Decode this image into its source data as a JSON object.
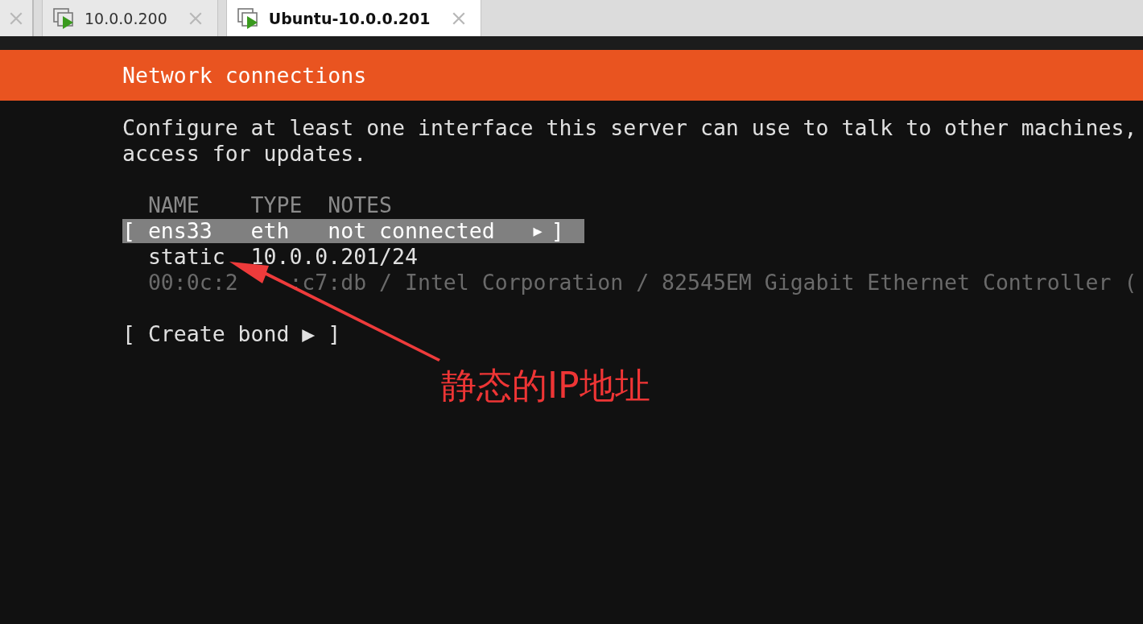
{
  "tabs": [
    {
      "label": "10.0.0.200",
      "selected": false
    },
    {
      "label": "Ubuntu-10.0.0.201",
      "selected": true
    }
  ],
  "header": {
    "title": "Network connections"
  },
  "description": [
    "Configure at least one interface this server can use to talk to other machines,",
    "access for updates."
  ],
  "table": {
    "columns": [
      "NAME",
      "TYPE",
      "NOTES"
    ],
    "rows": [
      {
        "open": "[",
        "name": "ens33",
        "type": "eth",
        "notes": "not connected",
        "marker": "▶",
        "close": "]",
        "selected": true,
        "address": {
          "method": "static",
          "value": "10.0.0.201/24"
        },
        "hardware": [
          "00:0c:2",
          ":c7:db / Intel Corporation / 82545EM Gigabit Ethernet Controller ("
        ]
      }
    ]
  },
  "buttons": [
    "[ Create bond ▶ ]"
  ],
  "annotation": {
    "text": "静态的IP地址"
  }
}
